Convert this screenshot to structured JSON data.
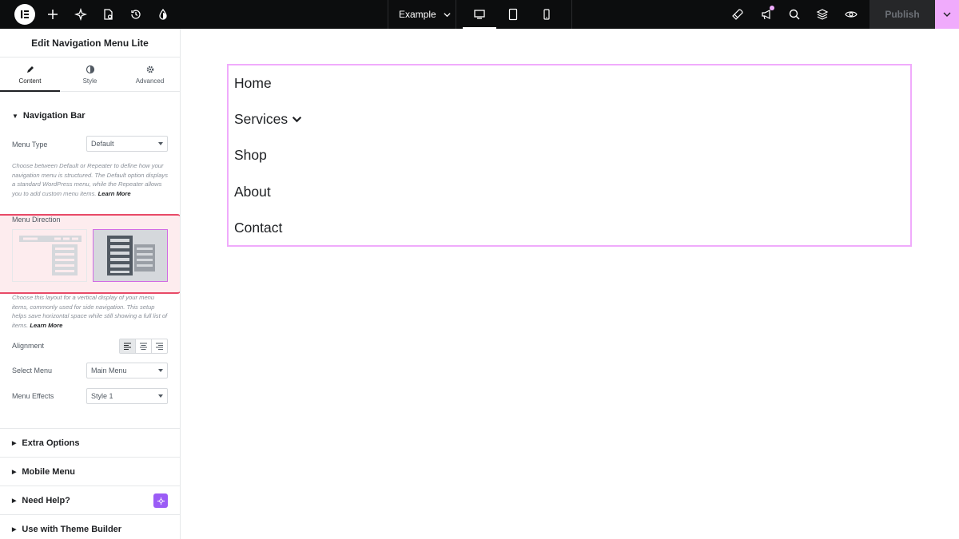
{
  "topbar": {
    "document_name": "Example",
    "publish_label": "Publish"
  },
  "panel": {
    "title": "Edit Navigation Menu Lite",
    "tabs": [
      {
        "label": "Content",
        "icon": "pencil-icon",
        "active": true
      },
      {
        "label": "Style",
        "icon": "half-circle-icon",
        "active": false
      },
      {
        "label": "Advanced",
        "icon": "gear-icon",
        "active": false
      }
    ],
    "navigation_bar": {
      "title": "Navigation Bar",
      "menu_type_label": "Menu Type",
      "menu_type_value": "Default",
      "menu_type_help": "Choose between Default or Repeater to define how your navigation menu is structured. The Default option displays a standard WordPress menu, while the Repeater allows you to add custom menu items.",
      "learn_more": "Learn More",
      "menu_direction_label": "Menu Direction",
      "menu_direction_help": "Choose this layout for a vertical display of your menu items, commonly used for side navigation. This setup helps save horizontal space while still showing a full list of items.",
      "alignment_label": "Alignment",
      "select_menu_label": "Select Menu",
      "select_menu_value": "Main Menu",
      "menu_effects_label": "Menu Effects",
      "menu_effects_value": "Style 1"
    },
    "sections": [
      {
        "label": "Extra Options"
      },
      {
        "label": "Mobile Menu"
      },
      {
        "label": "Need Help?"
      },
      {
        "label": "Use with Theme Builder"
      }
    ]
  },
  "canvas": {
    "menu_items": [
      "Home",
      "Services",
      "Shop",
      "About",
      "Contact"
    ]
  },
  "colors": {
    "accent_pink": "#f0abfc",
    "highlight_red": "#e84a67",
    "topbar_bg": "#0c0d0e"
  }
}
